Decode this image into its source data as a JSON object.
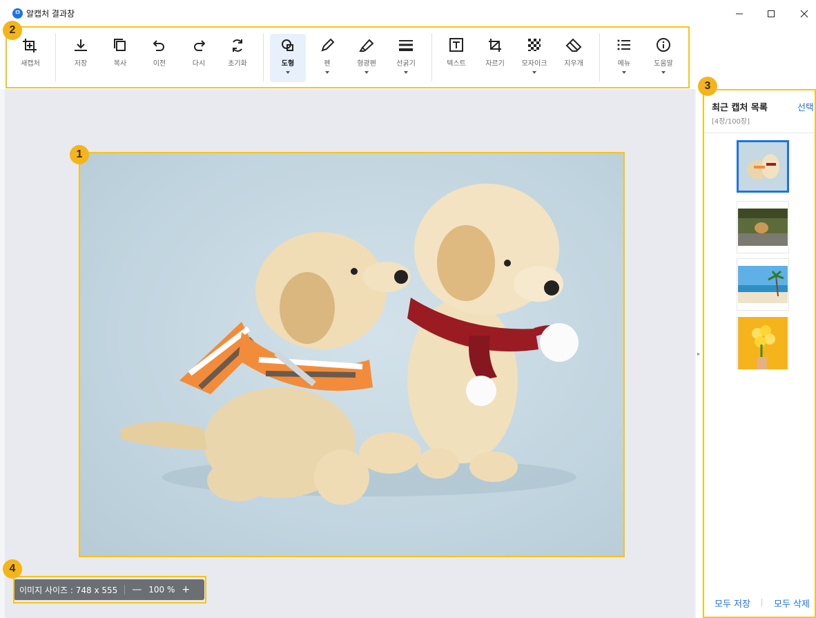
{
  "window": {
    "title": "알캡처 결과창",
    "logo_text": "ㅁ"
  },
  "toolbar": {
    "items": [
      {
        "label": "새캡처",
        "icon": "crop-add-icon"
      },
      {
        "label": "저장",
        "icon": "download-icon"
      },
      {
        "label": "복사",
        "icon": "copy-icon"
      },
      {
        "label": "이전",
        "icon": "undo-icon"
      },
      {
        "label": "다시",
        "icon": "redo-icon"
      },
      {
        "label": "초기화",
        "icon": "refresh-icon"
      },
      {
        "label": "도형",
        "icon": "shape-icon",
        "active": true,
        "dropdown": true
      },
      {
        "label": "펜",
        "icon": "pen-icon",
        "dropdown": true
      },
      {
        "label": "형광펜",
        "icon": "highlighter-icon",
        "dropdown": true
      },
      {
        "label": "선굵기",
        "icon": "line-weight-icon",
        "dropdown": true
      },
      {
        "label": "텍스트",
        "icon": "text-icon"
      },
      {
        "label": "자르기",
        "icon": "crop-icon"
      },
      {
        "label": "모자이크",
        "icon": "mosaic-icon",
        "dropdown": true
      },
      {
        "label": "지우개",
        "icon": "eraser-icon"
      },
      {
        "label": "메뉴",
        "icon": "menu-icon",
        "dropdown": true
      },
      {
        "label": "도움말",
        "icon": "help-icon",
        "dropdown": true
      }
    ]
  },
  "canvas": {
    "image_alt": "두 마리 강아지"
  },
  "zoom": {
    "size_text": "이미지 사이즈 : 748 x 555",
    "minus": "—",
    "percent": "100 %",
    "plus": "+"
  },
  "sidebar": {
    "title": "최근 캡처 목록",
    "select_label": "선택",
    "count": "[4장/100장]",
    "thumbnails": [
      "puppies",
      "outdoor-dog",
      "beach",
      "flowers"
    ],
    "save_all": "모두 저장",
    "delete_all": "모두 삭제"
  },
  "callouts": [
    "1",
    "2",
    "3",
    "4"
  ],
  "colors": {
    "accent": "#1a73e8",
    "callout": "#f5b51a",
    "canvas_bg": "#e8eaf0"
  }
}
